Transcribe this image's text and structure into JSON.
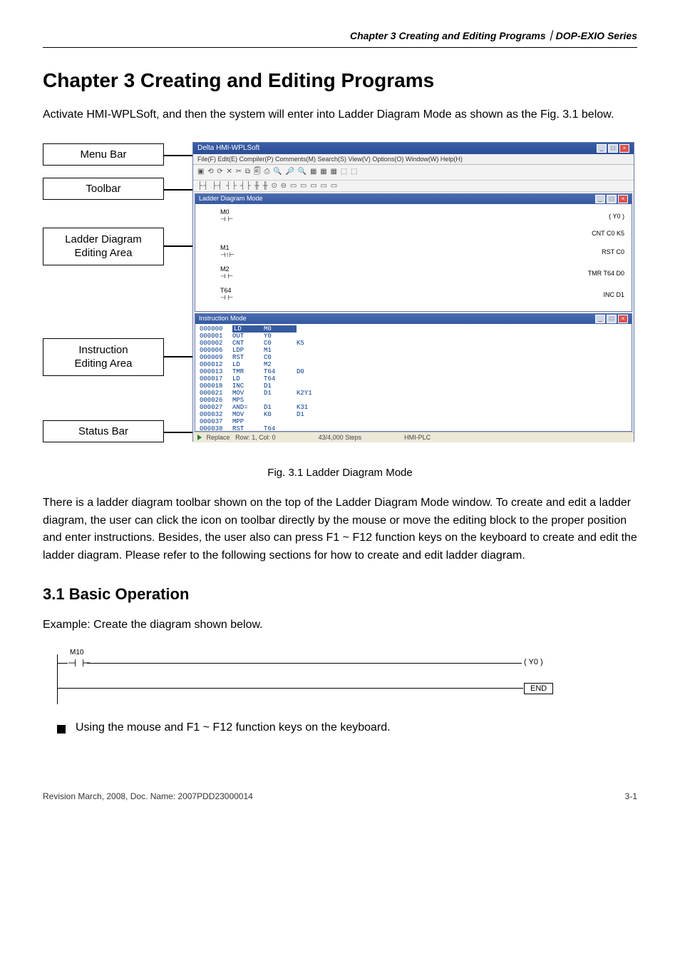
{
  "header_line": "Chapter 3 Creating and Editing Programs｜DOP-EXIO Series",
  "chapter_title": "Chapter 3    Creating and Editing Programs",
  "intro": "Activate HMI-WPLSoft, and then the system will enter into Ladder Diagram Mode as shown as the Fig. 3.1 below.",
  "labels": {
    "menu_bar": "Menu Bar",
    "toolbar": "Toolbar",
    "ladder1": "Ladder Diagram",
    "ladder2": "Editing Area",
    "instr1": "Instruction",
    "instr2": "Editing Area",
    "status": "Status Bar"
  },
  "screenshot": {
    "app_title": "Delta HMI-WPLSoft",
    "menubar": "File(F)  Edit(E)  Compiler(P)  Comments(M)  Search(S)  View(V)  Options(O)  Window(W)  Help(H)",
    "toolbar1": "▣ ⟲ ⟳ ✕ ✂ ⧉ 🗐 ⎙ 🔍 🔎 🔍   ▦ ▦ ▦ ⬚ ⬚",
    "toolbar2": "├┤ ├┤ ┤├ ┤├ ╫ ╫ ⊙ ⊖ ▭ ▭ ▭ ▭ ▭",
    "ladder_title": "Ladder Diagram Mode",
    "instr_title": "Instruction Mode",
    "ladder_items": [
      {
        "left": "M0",
        "right": "( Y0 )"
      },
      {
        "left": "",
        "right": "CNT    C0      K5"
      },
      {
        "left": "M1",
        "right": "RST    C0"
      },
      {
        "left": "M2",
        "right": "TMR    T64     D0"
      },
      {
        "left": "T64",
        "right": "INC    D1"
      }
    ],
    "instructions": [
      {
        "addr": "000000",
        "op": "LD",
        "a1": "M0",
        "a2": ""
      },
      {
        "addr": "000001",
        "op": "OUT",
        "a1": "Y0",
        "a2": ""
      },
      {
        "addr": "000002",
        "op": "CNT",
        "a1": "C0",
        "a2": "K5"
      },
      {
        "addr": "000006",
        "op": "LDP",
        "a1": "M1",
        "a2": ""
      },
      {
        "addr": "000009",
        "op": "RST",
        "a1": "C0",
        "a2": ""
      },
      {
        "addr": "000012",
        "op": "LD",
        "a1": "M2",
        "a2": ""
      },
      {
        "addr": "000013",
        "op": "TMR",
        "a1": "T64",
        "a2": "D0"
      },
      {
        "addr": "000017",
        "op": "LD",
        "a1": "T64",
        "a2": ""
      },
      {
        "addr": "000018",
        "op": "INC",
        "a1": "D1",
        "a2": ""
      },
      {
        "addr": "000021",
        "op": "MOV",
        "a1": "D1",
        "a2": "K2Y1"
      },
      {
        "addr": "000026",
        "op": "MPS",
        "a1": "",
        "a2": ""
      },
      {
        "addr": "000027",
        "op": "AND=",
        "a1": "D1",
        "a2": "K31"
      },
      {
        "addr": "000032",
        "op": "MOV",
        "a1": "K0",
        "a2": "D1"
      },
      {
        "addr": "000037",
        "op": "MPP",
        "a1": "",
        "a2": ""
      },
      {
        "addr": "000038",
        "op": "RST",
        "a1": "T64",
        "a2": ""
      }
    ],
    "status": {
      "mode": "Replace",
      "pos": "Row: 1, Col: 0",
      "steps": "43/4,000 Steps",
      "conn": "HMI-PLC"
    }
  },
  "caption": "Fig. 3.1 Ladder Diagram Mode",
  "para2": "There is a ladder diagram toolbar shown on the top of the Ladder Diagram Mode window. To create and edit a ladder diagram, the user can click the icon on toolbar directly by the mouse or move the editing block to the proper position and enter instructions. Besides, the user also can press F1 ~ F12 function keys on the keyboard to create and edit the ladder diagram. Please refer to the following sections for how to create and edit ladder diagram.",
  "section_title": "3.1     Basic Operation",
  "example_intro": "Example: Create the diagram shown below.",
  "example": {
    "contact": "M10",
    "coil": "( Y0        )",
    "end": "END"
  },
  "bullet": "Using the mouse and F1 ~ F12 function keys on the keyboard.",
  "footer_left": "Revision March, 2008, Doc. Name: 2007PDD23000014",
  "footer_right": "3-1"
}
